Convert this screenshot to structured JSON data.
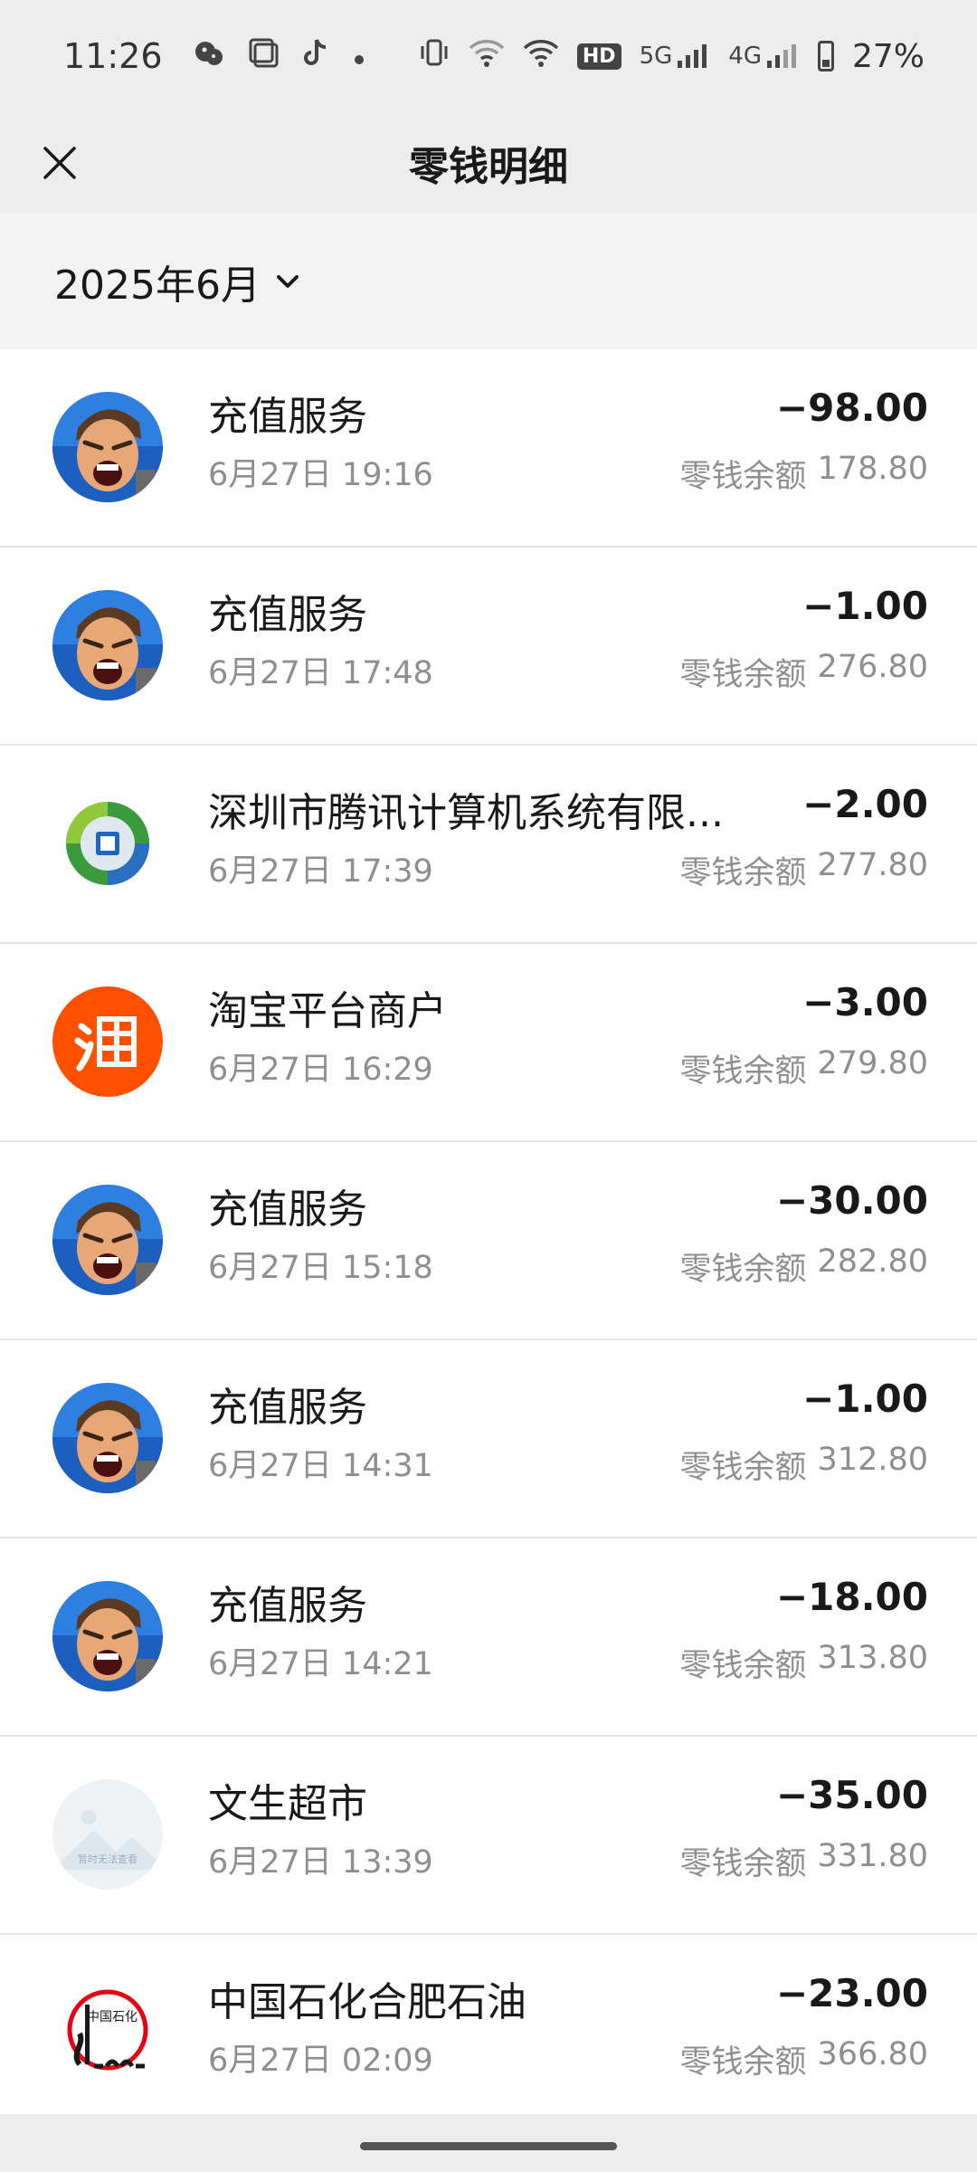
{
  "status_bar": {
    "time": "11:26",
    "network_5g": "5G",
    "network_4g": "4G",
    "hd_badge": "HD",
    "battery": "27%"
  },
  "header": {
    "title": "零钱明细"
  },
  "month_filter": {
    "label": "2025年6月"
  },
  "balance_label": "零钱余额",
  "transactions": [
    {
      "title": "充值服务",
      "time": "6月27日 19:16",
      "amount": "−98.00",
      "balance": "178.80",
      "icon": "game-avatar-icon"
    },
    {
      "title": "充值服务",
      "time": "6月27日 17:48",
      "amount": "−1.00",
      "balance": "276.80",
      "icon": "game-avatar-icon"
    },
    {
      "title": "深圳市腾讯计算机系统有限...",
      "time": "6月27日 17:39",
      "amount": "−2.00",
      "balance": "277.80",
      "icon": "tencent-logo-icon"
    },
    {
      "title": "淘宝平台商户",
      "time": "6月27日 16:29",
      "amount": "−3.00",
      "balance": "279.80",
      "icon": "taobao-logo-icon"
    },
    {
      "title": "充值服务",
      "time": "6月27日 15:18",
      "amount": "−30.00",
      "balance": "282.80",
      "icon": "game-avatar-icon"
    },
    {
      "title": "充值服务",
      "time": "6月27日 14:31",
      "amount": "−1.00",
      "balance": "312.80",
      "icon": "game-avatar-icon"
    },
    {
      "title": "充值服务",
      "time": "6月27日 14:21",
      "amount": "−18.00",
      "balance": "313.80",
      "icon": "game-avatar-icon"
    },
    {
      "title": "文生超市",
      "time": "6月27日 13:39",
      "amount": "−35.00",
      "balance": "331.80",
      "icon": "placeholder-image-icon",
      "icon_text": "暂时无法查看"
    },
    {
      "title": "中国石化合肥石油",
      "time": "6月27日 02:09",
      "amount": "−23.00",
      "balance": "366.80",
      "icon": "sinopec-logo-icon",
      "icon_text": "中国石化"
    }
  ],
  "colors": {
    "header_bg": "#ededed",
    "month_bar_bg": "#f3f3f3",
    "taobao_orange": "#ff5000",
    "sinopec_red": "#e60012"
  }
}
